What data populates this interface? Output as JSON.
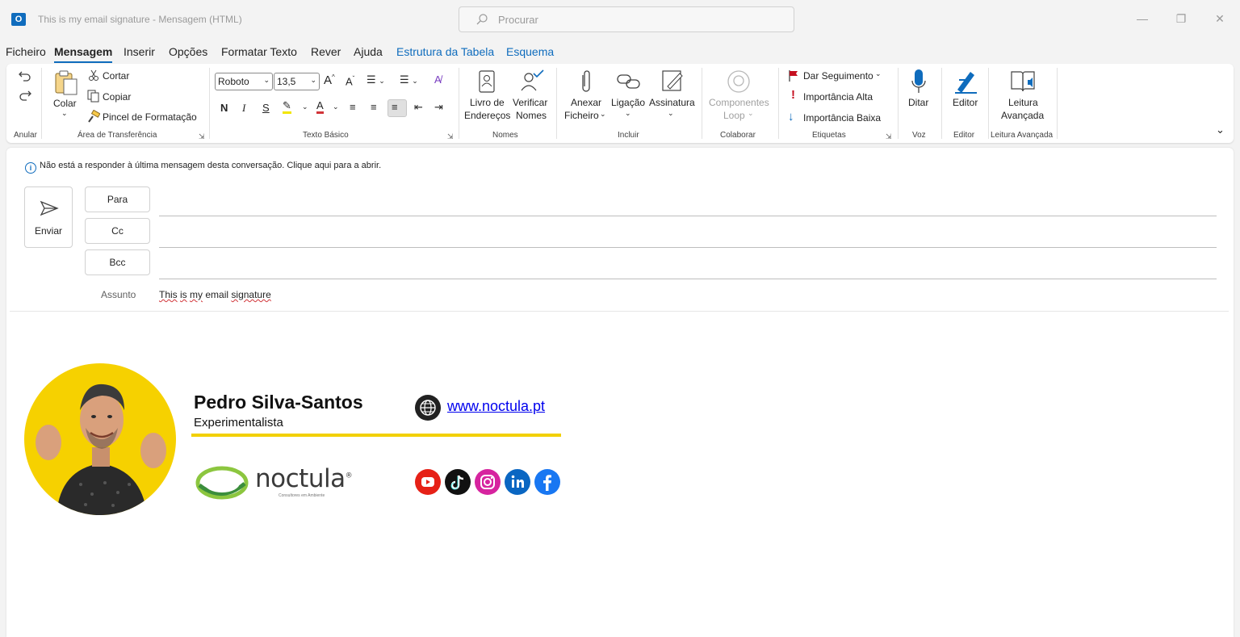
{
  "window": {
    "title": "This is my email signature  -  Mensagem (HTML)",
    "search_placeholder": "Procurar",
    "app_icon_letter": "O"
  },
  "menu": {
    "tabs": [
      "Ficheiro",
      "Mensagem",
      "Inserir",
      "Opções",
      "Formatar Texto",
      "Rever",
      "Ajuda",
      "Estrutura da Tabela",
      "Esquema"
    ],
    "active_tab": "Mensagem"
  },
  "ribbon": {
    "undo_group": {
      "label": "Anular"
    },
    "clipboard": {
      "label": "Área de Transferência",
      "paste": "Colar",
      "cut": "Cortar",
      "copy": "Copiar",
      "format_painter": "Pincel de Formatação"
    },
    "basic_text": {
      "label": "Texto Básico",
      "font": "Roboto",
      "size": "13,5",
      "bold": "N",
      "italic": "I",
      "underline": "S"
    },
    "names": {
      "label": "Nomes",
      "address_book_1": "Livro de",
      "address_book_2": "Endereços",
      "check_names_1": "Verificar",
      "check_names_2": "Nomes"
    },
    "include": {
      "label": "Incluir",
      "attach_1": "Anexar",
      "attach_2": "Ficheiro",
      "link": "Ligação",
      "signature": "Assinatura"
    },
    "collaborate": {
      "label": "Colaborar",
      "loop_1": "Componentes",
      "loop_2": "Loop"
    },
    "tags": {
      "label": "Etiquetas",
      "follow_up": "Dar Seguimento",
      "high": "Importância Alta",
      "low": "Importância Baixa"
    },
    "voice": {
      "label": "Voz",
      "dictate": "Ditar"
    },
    "editor": {
      "label": "Editor",
      "editor": "Editor"
    },
    "immersive": {
      "label": "Leitura Avançada",
      "reader_1": "Leitura",
      "reader_2": "Avançada"
    }
  },
  "compose": {
    "info_message": "Não está a responder à última mensagem desta conversação. Clique aqui para a abrir.",
    "send": "Enviar",
    "to": "Para",
    "cc": "Cc",
    "bcc": "Bcc",
    "subject_label": "Assunto",
    "subject_words": [
      "This",
      "is",
      "my",
      "email",
      "signature"
    ]
  },
  "signature": {
    "name": "Pedro Silva-Santos",
    "role": "Experimentalista",
    "website": "www.noctula.pt",
    "logo_text": "noctula",
    "logo_reg": "®",
    "logo_tagline": "Consultores em Ambiente",
    "social_icons": [
      "youtube-icon",
      "tiktok-icon",
      "instagram-icon",
      "linkedin-icon",
      "facebook-icon"
    ]
  },
  "colors": {
    "accent": "#0f6cbd",
    "signature_yellow": "#f2d000",
    "link": "#0000ee",
    "youtube": "#e62117",
    "tiktok": "#111111",
    "instagram": "#d6249f",
    "linkedin": "#0a66c2",
    "facebook": "#1877f2",
    "flag_red": "#c50f1f"
  }
}
